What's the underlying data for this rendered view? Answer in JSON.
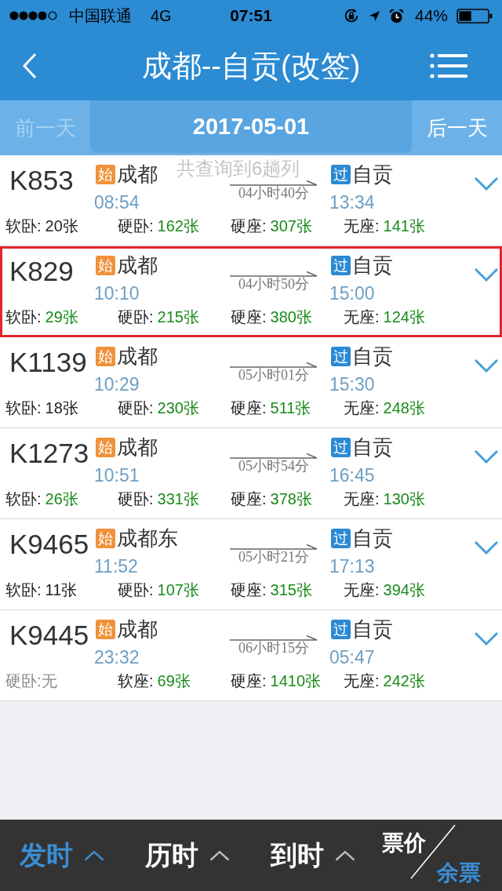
{
  "status_bar": {
    "carrier": "中国联通",
    "network": "4G",
    "time": "07:51",
    "battery": "44%"
  },
  "header": {
    "title": "成都--自贡(改签)"
  },
  "date_bar": {
    "prev": {
      "label": "前一天",
      "disabled": true
    },
    "date": "2017-05-01",
    "next": {
      "label": "后一天",
      "disabled": false
    }
  },
  "toast": "共查询到6趟列",
  "trains": [
    {
      "number": "K853",
      "highlighted": false,
      "from": {
        "badge": {
          "text": "始",
          "kind": "origin"
        },
        "station": "成都",
        "time": "08:54"
      },
      "duration": "04小时40分",
      "to": {
        "badge": {
          "text": "过",
          "kind": "passing"
        },
        "station": "自贡",
        "time": "13:34"
      },
      "seats": [
        {
          "label": "软卧:",
          "count": "20张",
          "kind": "limited"
        },
        {
          "label": "硬卧:",
          "count": "162张",
          "kind": "available"
        },
        {
          "label": "硬座:",
          "count": "307张",
          "kind": "available"
        },
        {
          "label": "无座:",
          "count": "141张",
          "kind": "available"
        }
      ]
    },
    {
      "number": "K829",
      "highlighted": true,
      "from": {
        "badge": {
          "text": "始",
          "kind": "origin"
        },
        "station": "成都",
        "time": "10:10"
      },
      "duration": "04小时50分",
      "to": {
        "badge": {
          "text": "过",
          "kind": "passing"
        },
        "station": "自贡",
        "time": "15:00"
      },
      "seats": [
        {
          "label": "软卧:",
          "count": "29张",
          "kind": "available"
        },
        {
          "label": "硬卧:",
          "count": "215张",
          "kind": "available"
        },
        {
          "label": "硬座:",
          "count": "380张",
          "kind": "available"
        },
        {
          "label": "无座:",
          "count": "124张",
          "kind": "available"
        }
      ]
    },
    {
      "number": "K1139",
      "highlighted": false,
      "from": {
        "badge": {
          "text": "始",
          "kind": "origin"
        },
        "station": "成都",
        "time": "10:29"
      },
      "duration": "05小时01分",
      "to": {
        "badge": {
          "text": "过",
          "kind": "passing"
        },
        "station": "自贡",
        "time": "15:30"
      },
      "seats": [
        {
          "label": "软卧:",
          "count": "18张",
          "kind": "limited"
        },
        {
          "label": "硬卧:",
          "count": "230张",
          "kind": "available"
        },
        {
          "label": "硬座:",
          "count": "511张",
          "kind": "available"
        },
        {
          "label": "无座:",
          "count": "248张",
          "kind": "available"
        }
      ]
    },
    {
      "number": "K1273",
      "highlighted": false,
      "from": {
        "badge": {
          "text": "始",
          "kind": "origin"
        },
        "station": "成都",
        "time": "10:51"
      },
      "duration": "05小时54分",
      "to": {
        "badge": {
          "text": "过",
          "kind": "passing"
        },
        "station": "自贡",
        "time": "16:45"
      },
      "seats": [
        {
          "label": "软卧:",
          "count": "26张",
          "kind": "available"
        },
        {
          "label": "硬卧:",
          "count": "331张",
          "kind": "available"
        },
        {
          "label": "硬座:",
          "count": "378张",
          "kind": "available"
        },
        {
          "label": "无座:",
          "count": "130张",
          "kind": "available"
        }
      ]
    },
    {
      "number": "K9465",
      "highlighted": false,
      "from": {
        "badge": {
          "text": "始",
          "kind": "origin"
        },
        "station": "成都东",
        "time": "11:52"
      },
      "duration": "05小时21分",
      "to": {
        "badge": {
          "text": "过",
          "kind": "passing"
        },
        "station": "自贡",
        "time": "17:13"
      },
      "seats": [
        {
          "label": "软卧:",
          "count": "11张",
          "kind": "limited"
        },
        {
          "label": "硬卧:",
          "count": "107张",
          "kind": "available"
        },
        {
          "label": "硬座:",
          "count": "315张",
          "kind": "available"
        },
        {
          "label": "无座:",
          "count": "394张",
          "kind": "available"
        }
      ]
    },
    {
      "number": "K9445",
      "highlighted": false,
      "from": {
        "badge": {
          "text": "始",
          "kind": "origin"
        },
        "station": "成都",
        "time": "23:32"
      },
      "duration": "06小时15分",
      "to": {
        "badge": {
          "text": "过",
          "kind": "passing"
        },
        "station": "自贡",
        "time": "05:47"
      },
      "seats": [
        {
          "label": "硬卧:",
          "count": "无",
          "kind": "none"
        },
        {
          "label": "软座:",
          "count": "69张",
          "kind": "available"
        },
        {
          "label": "硬座:",
          "count": "1410张",
          "kind": "available"
        },
        {
          "label": "无座:",
          "count": "242张",
          "kind": "available"
        }
      ]
    }
  ],
  "sort_bar": {
    "tabs": [
      {
        "label": "发时",
        "selected": true
      },
      {
        "label": "历时",
        "selected": false
      },
      {
        "label": "到时",
        "selected": false
      }
    ],
    "toggle": {
      "options": [
        {
          "label": "票价",
          "selected": false
        },
        {
          "label": "余票",
          "selected": true
        }
      ]
    }
  }
}
